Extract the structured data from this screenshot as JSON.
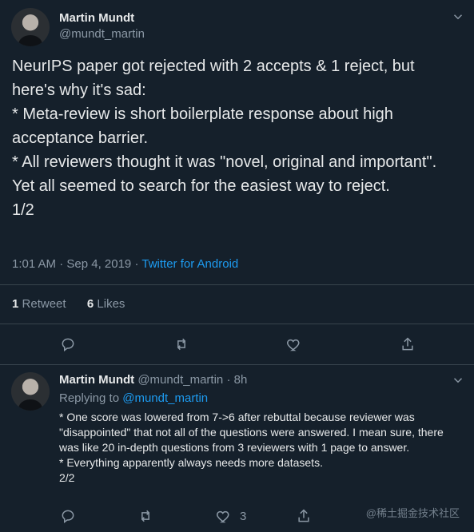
{
  "tweet": {
    "author": "Martin Mundt",
    "handle": "@mundt_martin",
    "text": "NeurIPS paper got rejected with 2 accepts & 1 reject, but here's why it's sad:\n* Meta-review is short boilerplate response about high acceptance barrier.\n* All reviewers thought it was \"novel, original and important\". Yet all seemed to search for the easiest way to reject.\n1/2",
    "time": "1:01 AM · Sep 4, 2019",
    "sep": "·",
    "source": "Twitter for Android",
    "retweets": "1",
    "retweets_label": "Retweet",
    "likes": "6",
    "likes_label": "Likes"
  },
  "reply": {
    "author": "Martin Mundt",
    "handle": "@mundt_martin",
    "age": "· 8h",
    "replying_to_label": "Replying to",
    "replying_to_handle": "@mundt_martin",
    "text": "* One score was lowered from 7->6 after rebuttal because reviewer was \"disappointed\" that not all of the questions were answered. I mean sure, there was like 20 in-depth questions from 3 reviewers with 1 page to answer.\n* Everything apparently always needs more datasets.\n2/2",
    "like_count": "3"
  },
  "watermark": "@稀土掘金技术社区",
  "icons": [
    "reply-icon",
    "retweet-icon",
    "like-icon",
    "share-icon",
    "chevron-down-icon"
  ]
}
